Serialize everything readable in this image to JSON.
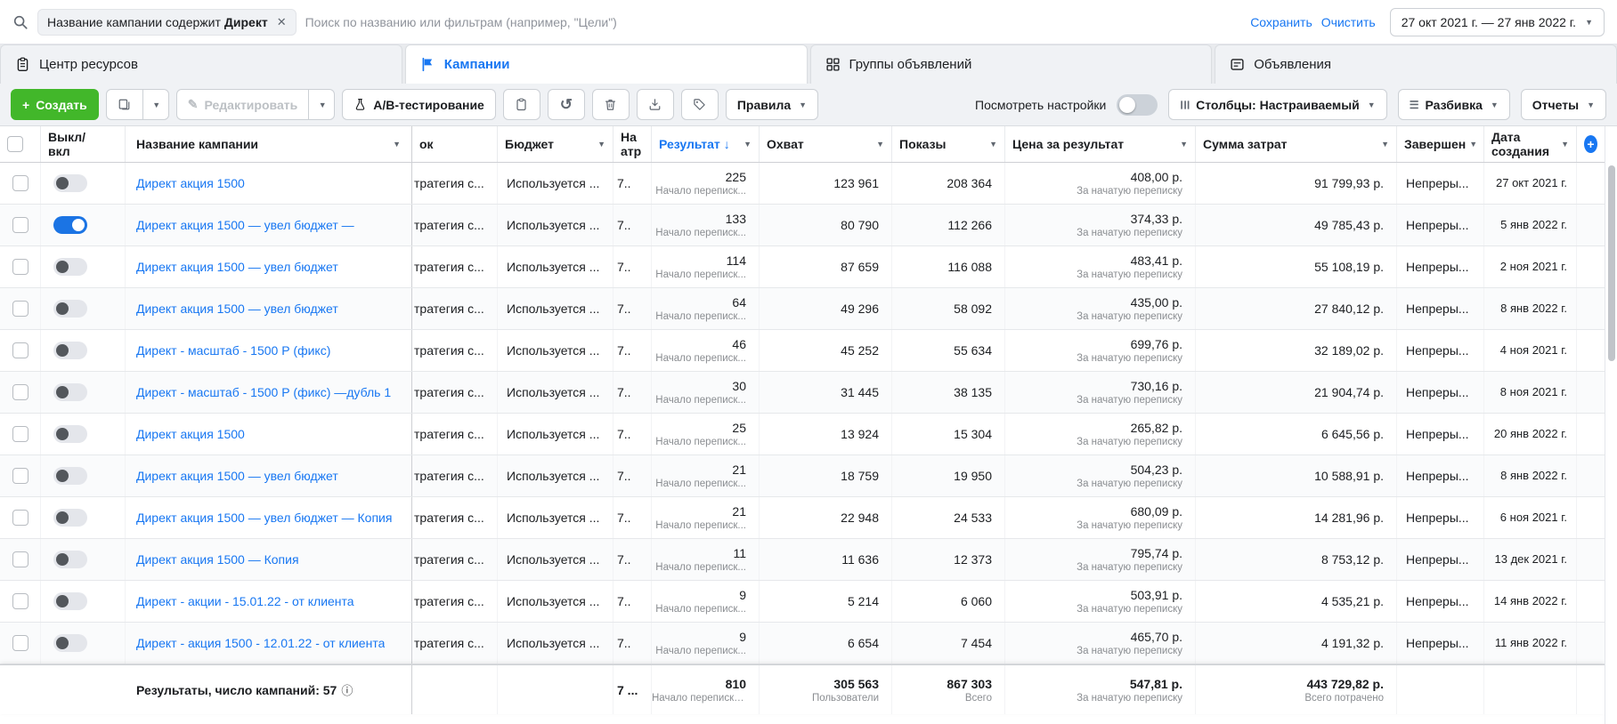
{
  "colors": {
    "accent_blue": "#1877f2",
    "create_green": "#42b72a",
    "text_dark": "#1c1e21",
    "text_gray": "#8a8d91"
  },
  "icons": {
    "close": "✕",
    "caret": "▼",
    "sort_down": "↓",
    "undo": "↺",
    "pencil": "✎",
    "plus": "+",
    "info": "ⓘ",
    "lines": "☰"
  },
  "topbar": {
    "filter_chip": {
      "text": "Название кампании содержит",
      "value": "Директ"
    },
    "search_placeholder": "Поиск по названию или фильтрам (например, \"Цели\")",
    "save_label": "Сохранить",
    "clear_label": "Очистить",
    "date_range": "27 окт 2021 г. — 27 янв 2022 г."
  },
  "tabs": [
    {
      "label": "Центр ресурсов"
    },
    {
      "label": "Кампании"
    },
    {
      "label": "Группы объявлений"
    },
    {
      "label": "Объявления"
    }
  ],
  "toolbar": {
    "create_label": "Создать",
    "edit_label": "Редактировать",
    "ab_test_label": "A/B-тестирование",
    "rules_label": "Правила",
    "view_settings_label": "Посмотреть настройки",
    "columns_label": "Столбцы: Настраиваемый",
    "breakdown_label": "Разбивка",
    "reports_label": "Отчеты"
  },
  "table": {
    "headers": {
      "toggle": "Выкл/\nвкл",
      "name": "Название кампании",
      "bid": "ок",
      "budget": "Бюджет",
      "attribution": "На\nатр",
      "result": "Результат",
      "reach": "Охват",
      "impressions": "Показы",
      "cost_per_result": "Цена за результат",
      "spent": "Сумма затрат",
      "ends": "Завершен",
      "created": "Дата создания"
    },
    "rows": [
      {
        "enabled": false,
        "name": "Директ акция 1500",
        "bid": "тратегия с...",
        "budget": "Используется ...",
        "attribution": "7..",
        "result": "225",
        "result_sub": "Начало переписк...",
        "reach": "123 961",
        "impressions": "208 364",
        "cost": "408,00 р.",
        "cost_sub": "За начатую переписку",
        "spent": "91 799,93 р.",
        "ends": "Непреры...",
        "created": "27 окт 2021 г."
      },
      {
        "enabled": true,
        "name": "Директ акция 1500 — увел бюджет —",
        "bid": "тратегия с...",
        "budget": "Используется ...",
        "attribution": "7..",
        "result": "133",
        "result_sub": "Начало переписк...",
        "reach": "80 790",
        "impressions": "112 266",
        "cost": "374,33 р.",
        "cost_sub": "За начатую переписку",
        "spent": "49 785,43 р.",
        "ends": "Непреры...",
        "created": "5 янв 2022 г."
      },
      {
        "enabled": false,
        "name": "Директ акция 1500 — увел бюджет",
        "bid": "тратегия с...",
        "budget": "Используется ...",
        "attribution": "7..",
        "result": "114",
        "result_sub": "Начало переписк...",
        "reach": "87 659",
        "impressions": "116 088",
        "cost": "483,41 р.",
        "cost_sub": "За начатую переписку",
        "spent": "55 108,19 р.",
        "ends": "Непреры...",
        "created": "2 ноя 2021 г."
      },
      {
        "enabled": false,
        "name": "Директ акция 1500 — увел бюджет",
        "bid": "тратегия с...",
        "budget": "Используется ...",
        "attribution": "7..",
        "result": "64",
        "result_sub": "Начало переписк...",
        "reach": "49 296",
        "impressions": "58 092",
        "cost": "435,00 р.",
        "cost_sub": "За начатую переписку",
        "spent": "27 840,12 р.",
        "ends": "Непреры...",
        "created": "8 янв 2022 г."
      },
      {
        "enabled": false,
        "name": "Директ - масштаб - 1500 Р (фикс)",
        "bid": "тратегия с...",
        "budget": "Используется ...",
        "attribution": "7..",
        "result": "46",
        "result_sub": "Начало переписк...",
        "reach": "45 252",
        "impressions": "55 634",
        "cost": "699,76 р.",
        "cost_sub": "За начатую переписку",
        "spent": "32 189,02 р.",
        "ends": "Непреры...",
        "created": "4 ноя 2021 г."
      },
      {
        "enabled": false,
        "name": "Директ - масштаб - 1500 Р (фикс) —дубль 1",
        "bid": "тратегия с...",
        "budget": "Используется ...",
        "attribution": "7..",
        "result": "30",
        "result_sub": "Начало переписк...",
        "reach": "31 445",
        "impressions": "38 135",
        "cost": "730,16 р.",
        "cost_sub": "За начатую переписку",
        "spent": "21 904,74 р.",
        "ends": "Непреры...",
        "created": "8 ноя 2021 г."
      },
      {
        "enabled": false,
        "name": "Директ акция 1500",
        "bid": "тратегия с...",
        "budget": "Используется ...",
        "attribution": "7..",
        "result": "25",
        "result_sub": "Начало переписк...",
        "reach": "13 924",
        "impressions": "15 304",
        "cost": "265,82 р.",
        "cost_sub": "За начатую переписку",
        "spent": "6 645,56 р.",
        "ends": "Непреры...",
        "created": "20 янв 2022 г."
      },
      {
        "enabled": false,
        "name": "Директ акция 1500 — увел бюджет",
        "bid": "тратегия с...",
        "budget": "Используется ...",
        "attribution": "7..",
        "result": "21",
        "result_sub": "Начало переписк...",
        "reach": "18 759",
        "impressions": "19 950",
        "cost": "504,23 р.",
        "cost_sub": "За начатую переписку",
        "spent": "10 588,91 р.",
        "ends": "Непреры...",
        "created": "8 янв 2022 г."
      },
      {
        "enabled": false,
        "name": "Директ акция 1500 — увел бюджет — Копия",
        "bid": "тратегия с...",
        "budget": "Используется ...",
        "attribution": "7..",
        "result": "21",
        "result_sub": "Начало переписк...",
        "reach": "22 948",
        "impressions": "24 533",
        "cost": "680,09 р.",
        "cost_sub": "За начатую переписку",
        "spent": "14 281,96 р.",
        "ends": "Непреры...",
        "created": "6 ноя 2021 г."
      },
      {
        "enabled": false,
        "name": "Директ акция 1500 — Копия",
        "bid": "тратегия с...",
        "budget": "Используется ...",
        "attribution": "7..",
        "result": "11",
        "result_sub": "Начало переписк...",
        "reach": "11 636",
        "impressions": "12 373",
        "cost": "795,74 р.",
        "cost_sub": "За начатую переписку",
        "spent": "8 753,12 р.",
        "ends": "Непреры...",
        "created": "13 дек 2021 г."
      },
      {
        "enabled": false,
        "name": "Директ - акции - 15.01.22 - от клиента",
        "bid": "тратегия с...",
        "budget": "Используется ...",
        "attribution": "7..",
        "result": "9",
        "result_sub": "Начало переписк...",
        "reach": "5 214",
        "impressions": "6 060",
        "cost": "503,91 р.",
        "cost_sub": "За начатую переписку",
        "spent": "4 535,21 р.",
        "ends": "Непреры...",
        "created": "14 янв 2022 г."
      },
      {
        "enabled": false,
        "name": "Директ - акция 1500 - 12.01.22 - от клиента",
        "bid": "тратегия с...",
        "budget": "Используется ...",
        "attribution": "7..",
        "result": "9",
        "result_sub": "Начало переписк...",
        "reach": "6 654",
        "impressions": "7 454",
        "cost": "465,70 р.",
        "cost_sub": "За начатую переписку",
        "spent": "4 191,32 р.",
        "ends": "Непреры...",
        "created": "11 янв 2022 г."
      }
    ],
    "footer": {
      "label": "Результаты, число кампаний: 57",
      "attribution": "7 ...",
      "result": "810",
      "result_sub": "Начало переписки ...",
      "reach": "305 563",
      "reach_sub": "Пользователи",
      "impressions": "867 303",
      "impressions_sub": "Всего",
      "cost_per_result": "547,81 р.",
      "cost_sub": "За начатую переписку",
      "spent": "443 729,82 р.",
      "spent_sub": "Всего потрачено"
    }
  }
}
